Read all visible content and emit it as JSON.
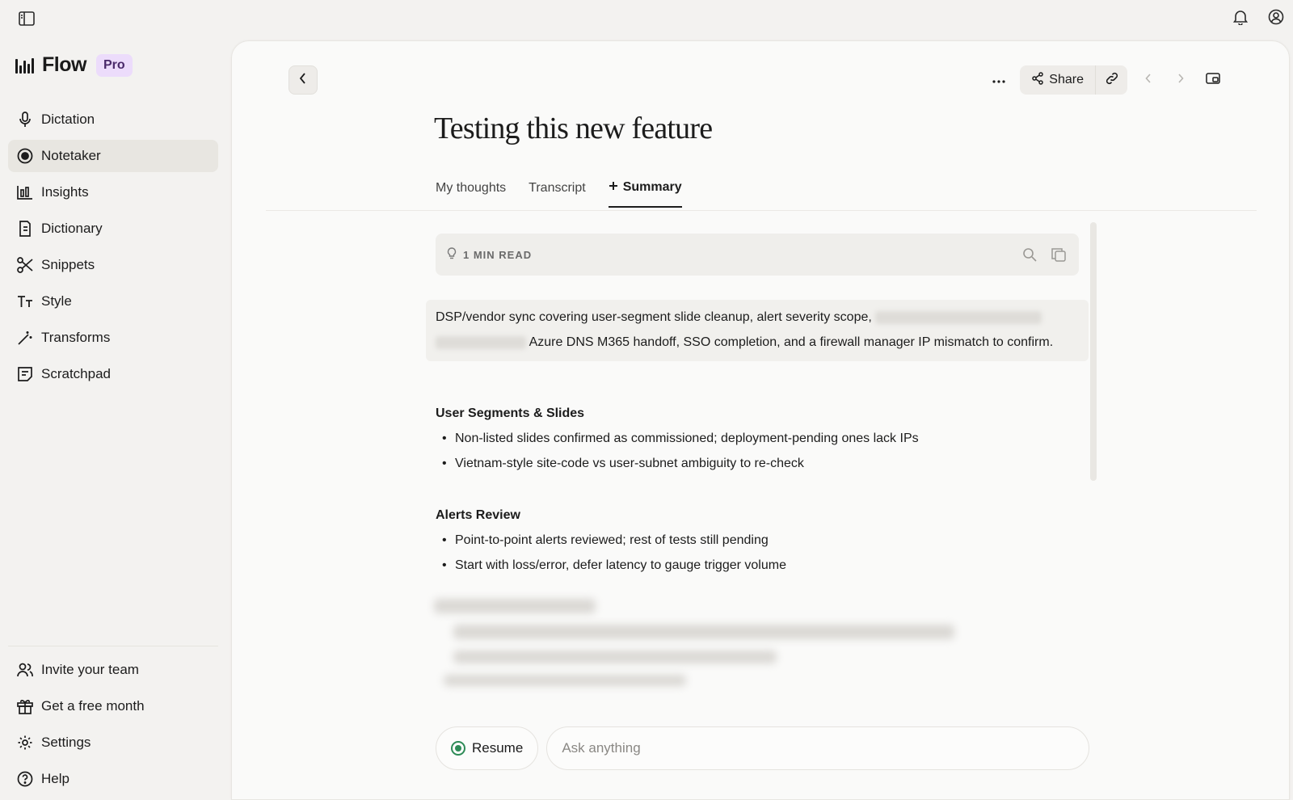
{
  "app": {
    "name": "Flow",
    "plan_badge": "Pro"
  },
  "sidebar": {
    "items": [
      {
        "label": "Dictation",
        "icon": "microphone-icon"
      },
      {
        "label": "Notetaker",
        "icon": "record-icon",
        "active": true
      },
      {
        "label": "Insights",
        "icon": "bar-chart-icon"
      },
      {
        "label": "Dictionary",
        "icon": "book-icon"
      },
      {
        "label": "Snippets",
        "icon": "scissors-icon"
      },
      {
        "label": "Style",
        "icon": "text-style-icon"
      },
      {
        "label": "Transforms",
        "icon": "magic-wand-icon"
      },
      {
        "label": "Scratchpad",
        "icon": "notepad-icon"
      }
    ],
    "bottom_items": [
      {
        "label": "Invite your team",
        "icon": "users-icon"
      },
      {
        "label": "Get a free month",
        "icon": "gift-icon"
      },
      {
        "label": "Settings",
        "icon": "gear-icon"
      },
      {
        "label": "Help",
        "icon": "help-icon"
      }
    ]
  },
  "toolbar": {
    "share_label": "Share"
  },
  "note": {
    "title": "Testing this new feature",
    "tabs": [
      {
        "label": "My thoughts"
      },
      {
        "label": "Transcript"
      },
      {
        "label": "Summary",
        "active": true
      }
    ],
    "read_time": "1 MIN READ",
    "intro_part1": "DSP/vendor sync covering user-segment slide cleanup, alert severity scope,",
    "intro_part2": "Azure DNS M365 handoff, SSO completion, and a firewall manager IP mismatch to confirm.",
    "sections": [
      {
        "heading": "User Segments & Slides",
        "bullets": [
          "Non-listed slides confirmed as commissioned; deployment-pending ones lack IPs",
          "Vietnam-style site-code vs user-subnet ambiguity to re-check"
        ]
      },
      {
        "heading": "Alerts Review",
        "bullets": [
          "Point-to-point alerts reviewed; rest of tests still pending",
          "Start with loss/error, defer latency to gauge trigger volume"
        ]
      }
    ]
  },
  "composer": {
    "resume_label": "Resume",
    "ask_placeholder": "Ask anything"
  }
}
